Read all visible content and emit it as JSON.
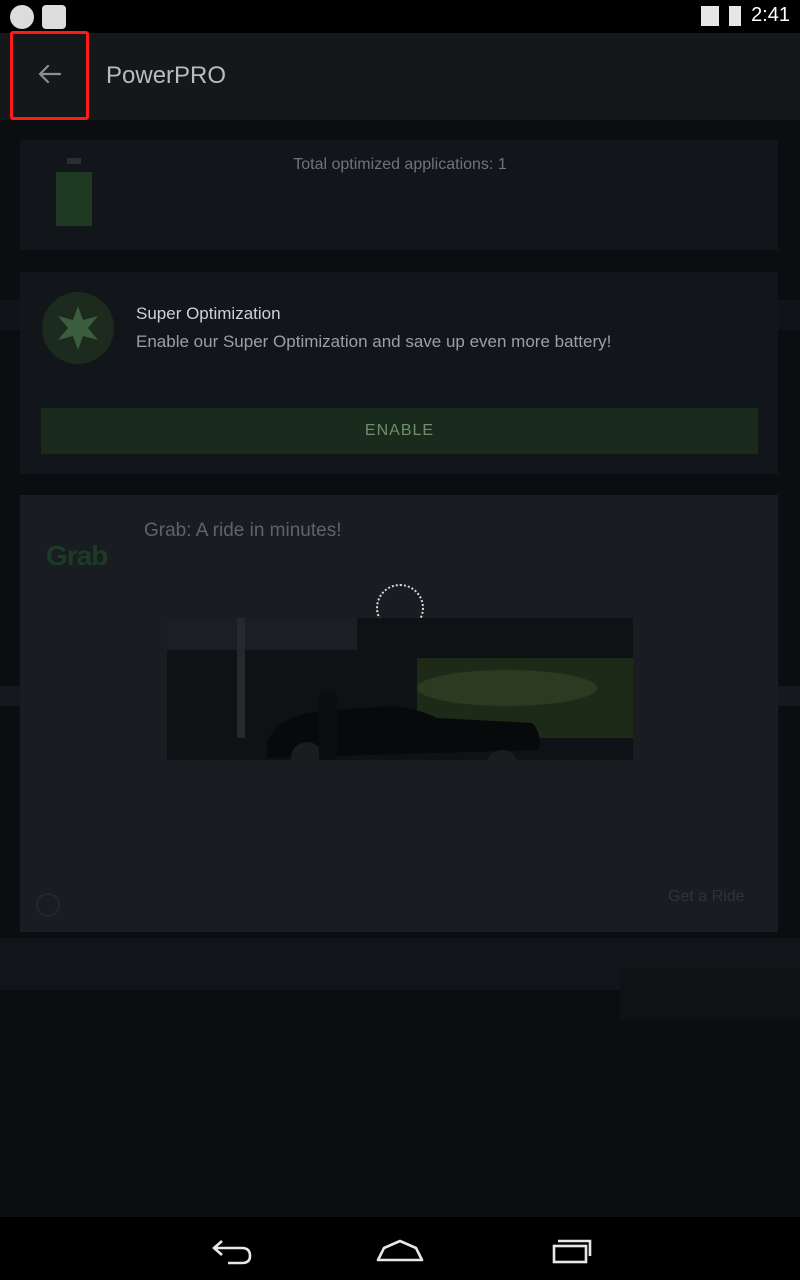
{
  "status_bar": {
    "time": "2:41"
  },
  "app_bar": {
    "title": "PowerPRO"
  },
  "summary_card": {
    "total_text": "Total optimized applications: 1"
  },
  "super_optimization": {
    "title": "Super Optimization",
    "description": "Enable our Super Optimization and save up even more battery!",
    "enable_label": "ENABLE"
  },
  "ad": {
    "logo": "Grab",
    "title": "Grab: A ride in minutes!",
    "cta": "Get a Ride"
  },
  "colors": {
    "highlight_border": "#ff1b1b",
    "background": "#0b0d10"
  },
  "icons": {
    "back": "arrow-left-icon",
    "battery": "battery-icon",
    "super": "star-badge-icon",
    "spinner": "loading-spinner-icon",
    "info": "info-icon",
    "nav_back": "nav-back-icon",
    "nav_home": "nav-home-icon",
    "nav_recents": "nav-recents-icon"
  }
}
